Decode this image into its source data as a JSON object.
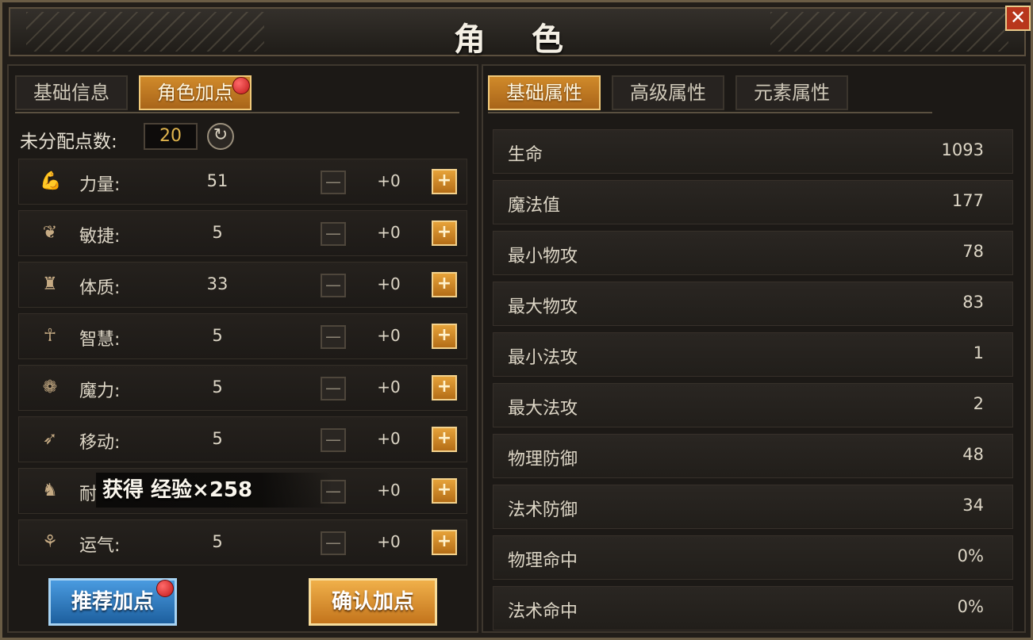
{
  "title": "角 色",
  "close_label": "✕",
  "left_tabs": [
    {
      "label": "基础信息",
      "active": false
    },
    {
      "label": "角色加点",
      "active": true
    }
  ],
  "unallocated": {
    "label": "未分配点数:",
    "value": "20"
  },
  "stats": [
    {
      "icon": "strength-icon",
      "glyph": "💪",
      "label": "力量:",
      "value": "51",
      "delta": "+0"
    },
    {
      "icon": "agility-icon",
      "glyph": "❦",
      "label": "敏捷:",
      "value": "5",
      "delta": "+0"
    },
    {
      "icon": "constitution-icon",
      "glyph": "♜",
      "label": "体质:",
      "value": "33",
      "delta": "+0"
    },
    {
      "icon": "wisdom-icon",
      "glyph": "☥",
      "label": "智慧:",
      "value": "5",
      "delta": "+0"
    },
    {
      "icon": "magic-icon",
      "glyph": "❁",
      "label": "魔力:",
      "value": "5",
      "delta": "+0"
    },
    {
      "icon": "movement-icon",
      "glyph": "➶",
      "label": "移动:",
      "value": "5",
      "delta": "+0"
    },
    {
      "icon": "endurance-icon",
      "glyph": "♞",
      "label": "耐",
      "value": "",
      "delta": "+0"
    },
    {
      "icon": "luck-icon",
      "glyph": "⚘",
      "label": "运气:",
      "value": "5",
      "delta": "+0"
    }
  ],
  "minus_label": "—",
  "plus_label": "+",
  "toast": "获得 经验×258",
  "recommend_label": "推荐加点",
  "confirm_label": "确认加点",
  "right_tabs": [
    {
      "label": "基础属性",
      "active": true
    },
    {
      "label": "高级属性",
      "active": false
    },
    {
      "label": "元素属性",
      "active": false
    }
  ],
  "attributes": [
    {
      "label": "生命",
      "value": "1093"
    },
    {
      "label": "魔法值",
      "value": "177"
    },
    {
      "label": "最小物攻",
      "value": "78"
    },
    {
      "label": "最大物攻",
      "value": "83"
    },
    {
      "label": "最小法攻",
      "value": "1"
    },
    {
      "label": "最大法攻",
      "value": "2"
    },
    {
      "label": "物理防御",
      "value": "48"
    },
    {
      "label": "法术防御",
      "value": "34"
    },
    {
      "label": "物理命中",
      "value": "0%"
    },
    {
      "label": "法术命中",
      "value": "0%"
    }
  ],
  "colors": {
    "accent": "#d08a2a",
    "recommend": "#2f7cc4",
    "notification": "#d42020"
  }
}
